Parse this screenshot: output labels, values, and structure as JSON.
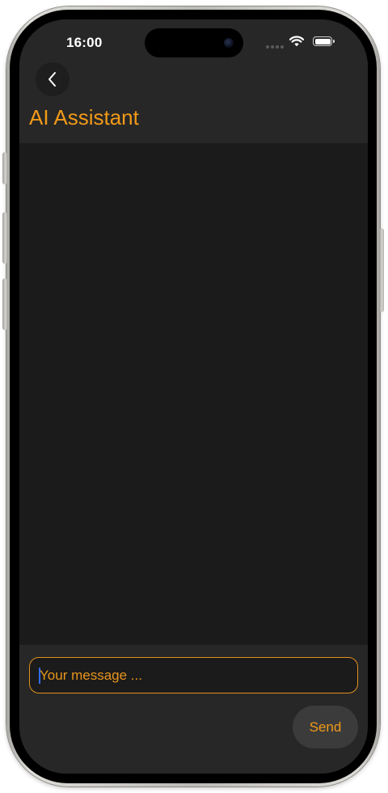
{
  "status_bar": {
    "time": "16:00"
  },
  "header": {
    "title": "AI Assistant",
    "back_icon": "chevron-left-icon"
  },
  "composer": {
    "input_value": "",
    "input_placeholder": "Your message ...",
    "send_label": "Send"
  },
  "colors": {
    "accent": "#f29a18",
    "header_bg": "#272727",
    "chat_bg": "#1b1b1b",
    "send_button_bg": "#3b3b3b",
    "caret": "#2f6cf2"
  }
}
